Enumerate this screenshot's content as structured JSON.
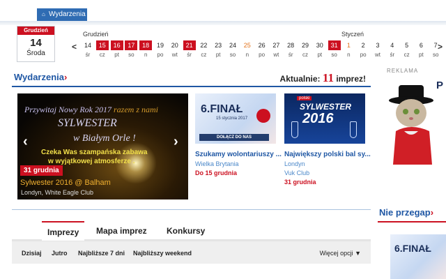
{
  "top_tab": {
    "label": "Wydarzenia"
  },
  "date_box": {
    "month": "Grudzień",
    "day": "14",
    "weekday": "Środa"
  },
  "calendar": {
    "month_left": "Grudzień",
    "month_right": "Styczeń",
    "prev_arrow": "<",
    "next_arrow": ">",
    "days": [
      {
        "n": "14",
        "d": "śr",
        "style": "normal"
      },
      {
        "n": "15",
        "d": "cz",
        "style": "red"
      },
      {
        "n": "16",
        "d": "pt",
        "style": "red"
      },
      {
        "n": "17",
        "d": "so",
        "style": "red"
      },
      {
        "n": "18",
        "d": "n",
        "style": "red"
      },
      {
        "n": "19",
        "d": "po",
        "style": "normal"
      },
      {
        "n": "20",
        "d": "wt",
        "style": "normal"
      },
      {
        "n": "21",
        "d": "śr",
        "style": "red"
      },
      {
        "n": "22",
        "d": "cz",
        "style": "normal"
      },
      {
        "n": "23",
        "d": "pt",
        "style": "normal"
      },
      {
        "n": "24",
        "d": "so",
        "style": "normal"
      },
      {
        "n": "25",
        "d": "n",
        "style": "orange"
      },
      {
        "n": "26",
        "d": "po",
        "style": "normal"
      },
      {
        "n": "27",
        "d": "wt",
        "style": "normal"
      },
      {
        "n": "28",
        "d": "śr",
        "style": "normal"
      },
      {
        "n": "29",
        "d": "cz",
        "style": "normal"
      },
      {
        "n": "30",
        "d": "pt",
        "style": "normal"
      },
      {
        "n": "31",
        "d": "so",
        "style": "red"
      },
      {
        "n": "1",
        "d": "n",
        "style": "orange"
      },
      {
        "n": "2",
        "d": "po",
        "style": "normal"
      },
      {
        "n": "3",
        "d": "wt",
        "style": "normal"
      },
      {
        "n": "4",
        "d": "śr",
        "style": "normal"
      },
      {
        "n": "5",
        "d": "cz",
        "style": "normal"
      },
      {
        "n": "6",
        "d": "pt",
        "style": "normal"
      },
      {
        "n": "7",
        "d": "so",
        "style": "normal"
      }
    ]
  },
  "section": {
    "title": "Wydarzenia",
    "arrow": "›",
    "aktualnie_label": "Aktualnie:",
    "aktualnie_count": "11",
    "aktualnie_suffix": "imprez!"
  },
  "slider": {
    "line1a": "Przywitaj Nowy Rok 2017",
    "line1b": "razem z nami",
    "line2": "SYLWESTER",
    "line3": "w Białym Orle !",
    "line4": "Czeka Was szampańska zabawa",
    "line5": "w wyjątkowej atmosferze .",
    "badge": "31 grudnia",
    "title": "Sylwester 2016 @ Balham",
    "subtitle": "Londyn, White Eagle Club",
    "prev": "‹",
    "next": "›"
  },
  "cards": [
    {
      "title": "Szukamy wolontariuszy ...",
      "sub1": "Wielka Brytania",
      "sub2": "",
      "date": "Do 15 grudnia",
      "img": {
        "big": "6.FINAŁ",
        "small": "15 stycznia 2017",
        "strip": "DOŁĄCZ DO NAS"
      }
    },
    {
      "title": "Największy polski bal sy...",
      "sub1": "Londyn",
      "sub2": "Vuk Club",
      "date": "31 grudnia",
      "img": {
        "badge": "polski",
        "w1": "SYLWESTER",
        "w2": "2016"
      }
    }
  ],
  "ad": {
    "label": "REKLAMA",
    "text": "P"
  },
  "nie_przegap": {
    "title": "Nie przegap",
    "arrow": "›",
    "img_big": "6.FINAŁ"
  },
  "tabs": [
    {
      "label": "Imprezy",
      "active": true
    },
    {
      "label": "Mapa imprez",
      "active": false
    },
    {
      "label": "Konkursy",
      "active": false
    }
  ],
  "filters": [
    "Dzisiaj",
    "Jutro",
    "Najbliższe 7 dni",
    "Najbliższy weekend"
  ],
  "more_options": "Więcej opcji ▼",
  "colors": {
    "brand_blue": "#1f57a4",
    "accent_red": "#cc1020"
  }
}
